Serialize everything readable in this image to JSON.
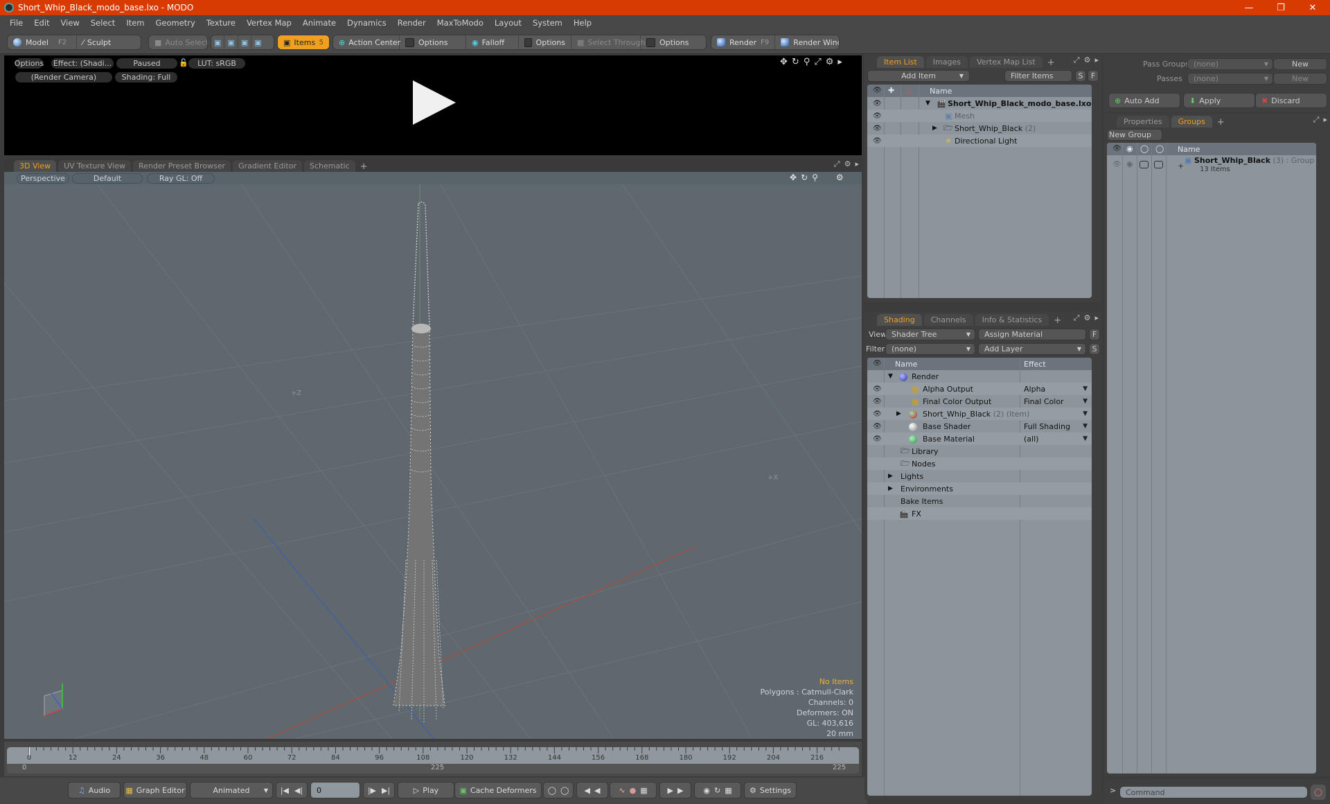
{
  "window": {
    "title": "Short_Whip_Black_modo_base.lxo - MODO",
    "controls": [
      "minimize",
      "restore",
      "close"
    ]
  },
  "menu": [
    "File",
    "Edit",
    "View",
    "Select",
    "Item",
    "Geometry",
    "Texture",
    "Vertex Map",
    "Animate",
    "Dynamics",
    "Render",
    "MaxToModo",
    "Layout",
    "System",
    "Help"
  ],
  "toolbar": {
    "model": "Model",
    "model_key": "F2",
    "sculpt": "Sculpt",
    "auto_select": "Auto Select",
    "items": "Items",
    "items_count": "5",
    "action_center": "Action Center",
    "options1": "Options",
    "falloff": "Falloff",
    "options2": "Options",
    "select_through": "Select Through",
    "options3": "Options",
    "render": "Render",
    "render_key": "F9",
    "render_window": "Render Window"
  },
  "preview": {
    "options": "Options",
    "effect": "Effect: (Shadi...",
    "status": "Paused",
    "lut": "LUT: sRGB",
    "camera": "(Render Camera)",
    "shading": "Shading: Full"
  },
  "viewport_tabs": {
    "tabs": [
      "3D View",
      "UV Texture View",
      "Render Preset Browser",
      "Gradient Editor",
      "Schematic"
    ],
    "active": "3D View",
    "add": "+"
  },
  "viewport": {
    "projection": "Perspective",
    "style": "Default",
    "raygl": "Ray GL: Off",
    "axis_label": "+Z",
    "stats": {
      "selection": "No Items",
      "polygons": "Polygons : Catmull-Clark",
      "channels": "Channels: 0",
      "deformers": "Deformers: ON",
      "gl": "GL: 403,616",
      "grid": "20 mm"
    },
    "gizmo": {
      "x": "X",
      "y": "Y",
      "z": "Z"
    }
  },
  "timeline": {
    "ticks": [
      "0",
      "12",
      "24",
      "36",
      "48",
      "60",
      "72",
      "84",
      "96",
      "108",
      "120",
      "132",
      "144",
      "156",
      "168",
      "180",
      "192",
      "204",
      "216"
    ],
    "range_start": "0",
    "range_mid": "225",
    "range_end": "225"
  },
  "bottombar": {
    "audio": "Audio",
    "graph_editor": "Graph Editor",
    "animated": "Animated",
    "frame": "0",
    "play": "Play",
    "cache_deformers": "Cache Deformers",
    "settings": "Settings"
  },
  "item_list": {
    "tabs": [
      "Item List",
      "Images",
      "Vertex Map List"
    ],
    "active": "Item List",
    "add_item": "Add Item",
    "filter": "Filter Items",
    "s": "S",
    "f": "F",
    "col_name": "Name",
    "rows": [
      {
        "name": "Short_Whip_Black_modo_base.lxo",
        "count": "",
        "bold": true
      },
      {
        "name": "Mesh",
        "count": "",
        "dim": true
      },
      {
        "name": "Short_Whip_Black",
        "count": "(2)"
      },
      {
        "name": "Directional Light",
        "count": ""
      }
    ]
  },
  "shading": {
    "tabs": [
      "Shading",
      "Channels",
      "Info & Statistics"
    ],
    "active": "Shading",
    "view_label": "View",
    "view_value": "Shader Tree",
    "assign_material": "Assign Material",
    "f": "F",
    "filter_label": "Filter",
    "filter_value": "(none)",
    "add_layer": "Add Layer",
    "s": "S",
    "col_name": "Name",
    "col_effect": "Effect",
    "rows": [
      {
        "name": "Render",
        "suffix": "",
        "effect": ""
      },
      {
        "name": "Alpha Output",
        "suffix": "",
        "effect": "Alpha"
      },
      {
        "name": "Final Color Output",
        "suffix": "",
        "effect": "Final Color"
      },
      {
        "name": "Short_Whip_Black",
        "suffix": "(2) (Item)",
        "effect": ""
      },
      {
        "name": "Base Shader",
        "suffix": "",
        "effect": "Full Shading"
      },
      {
        "name": "Base Material",
        "suffix": "",
        "effect": "(all)"
      },
      {
        "name": "Library",
        "suffix": "",
        "effect": ""
      },
      {
        "name": "Nodes",
        "suffix": "",
        "effect": ""
      },
      {
        "name": "Lights",
        "suffix": "",
        "effect": ""
      },
      {
        "name": "Environments",
        "suffix": "",
        "effect": ""
      },
      {
        "name": "Bake Items",
        "suffix": "",
        "effect": ""
      },
      {
        "name": "FX",
        "suffix": "",
        "effect": ""
      }
    ]
  },
  "passes": {
    "pass_groups_label": "Pass Groups",
    "pass_groups_value": "(none)",
    "passes_label": "Passes",
    "passes_value": "(none)",
    "new": "New",
    "auto_add": "Auto Add",
    "apply": "Apply",
    "discard": "Discard"
  },
  "groups": {
    "tabs": [
      "Properties",
      "Groups"
    ],
    "active": "Groups",
    "new_group": "New Group",
    "col_name": "Name",
    "group_name": "Short_Whip_Black",
    "group_count": "(3)",
    "group_type": ": Group",
    "group_items": "13 Items"
  },
  "command": {
    "prompt": ">",
    "placeholder": "Command"
  },
  "colors": {
    "title_bar": "#d83b01",
    "accent": "#f0a020",
    "viewport_bg": "#5f686f",
    "table_bg": "#8d959c"
  }
}
